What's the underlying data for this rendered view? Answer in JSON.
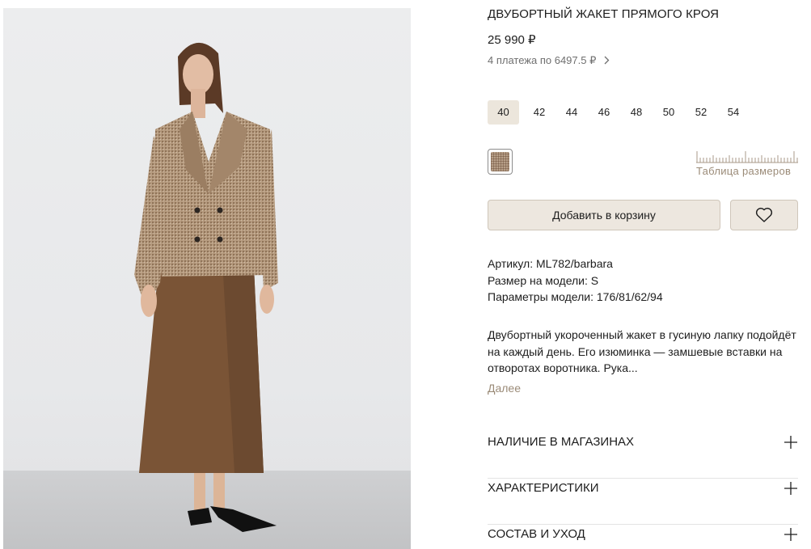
{
  "product": {
    "title": "ДВУБОРТНЫЙ ЖАКЕТ ПРЯМОГО КРОЯ",
    "price": "25 990 ₽",
    "installments": "4 платежа по 6497.5 ₽",
    "sizes": [
      "40",
      "42",
      "44",
      "46",
      "48",
      "50",
      "52",
      "54"
    ],
    "selected_size": "40",
    "size_chart_link": "Таблица размеров",
    "add_to_cart": "Добавить в корзину",
    "details": {
      "article": "Артикул: ML782/barbara",
      "model_size": "Размер на модели: S",
      "model_params": "Параметры модели: 176/81/62/94"
    },
    "description": "Двубортный укороченный жакет в гусиную лапку подойдёт на каждый день. Его изюминка — замшевые вставки на отворотах воротника. Рука...",
    "more_link": "Далее"
  },
  "accordions": [
    {
      "label": "НАЛИЧИЕ В МАГАЗИНАХ"
    },
    {
      "label": "ХАРАКТЕРИСТИКИ"
    },
    {
      "label": "СОСТАВ И УХОД"
    }
  ],
  "colors": {
    "accent_bg": "#ede7df",
    "link": "#9b8b78",
    "swatch": "#b79f88"
  },
  "icons": {
    "favorite": "heart-icon",
    "installments": "chevron-right-icon",
    "expand": "plus-icon",
    "size_chart": "ruler-icon"
  }
}
